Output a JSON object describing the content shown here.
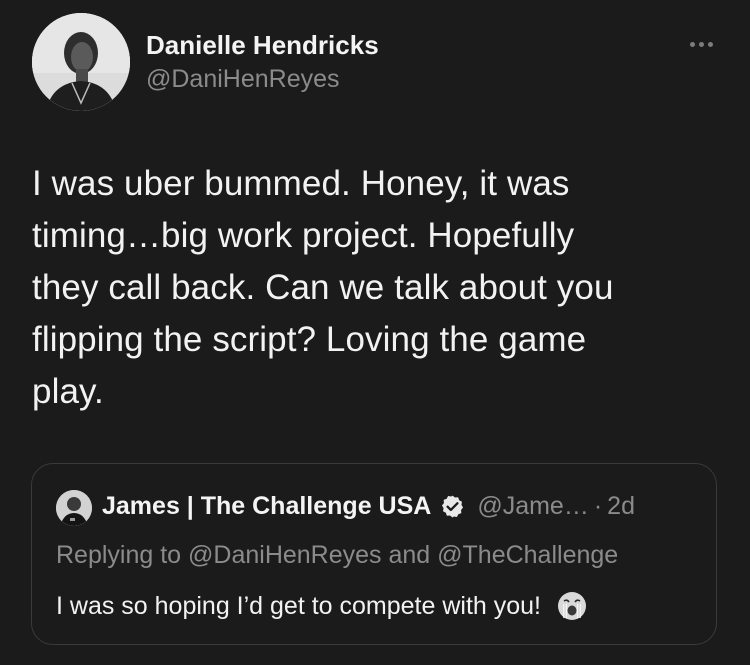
{
  "author": {
    "name": "Danielle Hendricks",
    "handle": "@DaniHenReyes",
    "avatar_icon": "profile-photo"
  },
  "more_icon": "more-horizontal-icon",
  "tweet": {
    "lines": [
      "I was uber bummed. Honey, it was",
      "timing…big work project. Hopefully",
      "they call back. Can we talk about you",
      "flipping the script? Loving the game",
      "play."
    ]
  },
  "quoted": {
    "name": "James | The Challenge USA",
    "verified_icon": "verified-badge-icon",
    "handle": "@Jame…",
    "separator": "·",
    "time": "2d",
    "replying_to": "Replying to @DaniHenReyes and @TheChallenge",
    "text": "I was so hoping I’d get to compete with you!",
    "emoji_icon": "crying-face-emoji"
  },
  "colors": {
    "background": "#1b1b1b",
    "primary_text": "#f2f2f2",
    "secondary_text": "#8b8b8b",
    "border": "#3a3a3a"
  }
}
